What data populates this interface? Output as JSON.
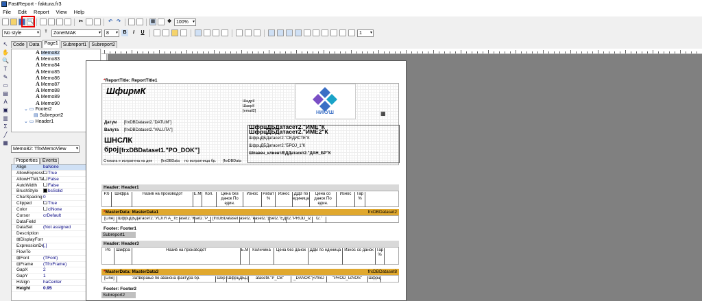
{
  "window": {
    "title": "FastReport - faktura.fr3"
  },
  "menu": [
    "File",
    "Edit",
    "Report",
    "View",
    "Help"
  ],
  "toolbar": {
    "zoom": "100%"
  },
  "format_bar": {
    "style": "No style",
    "font": "ZoneIMAK",
    "size": "8",
    "bold": "B",
    "italic": "I",
    "underline": "U",
    "frame_width": "1"
  },
  "design_tabs": [
    "Code",
    "Data",
    "Page1",
    "Subreport1",
    "Subreport2"
  ],
  "tree": {
    "items": [
      {
        "label": "Memo82",
        "type": "memo",
        "selected": true
      },
      {
        "label": "Memo83",
        "type": "memo"
      },
      {
        "label": "Memo84",
        "type": "memo"
      },
      {
        "label": "Memo85",
        "type": "memo"
      },
      {
        "label": "Memo86",
        "type": "memo"
      },
      {
        "label": "Memo87",
        "type": "memo"
      },
      {
        "label": "Memo88",
        "type": "memo"
      },
      {
        "label": "Memo89",
        "type": "memo"
      },
      {
        "label": "Memo90",
        "type": "memo"
      },
      {
        "label": "Footer2",
        "type": "band"
      },
      {
        "label": "Subreport2",
        "type": "sub"
      },
      {
        "label": "Header1",
        "type": "band"
      }
    ]
  },
  "object_combo": "Memo82: TfrxMemoView",
  "prop_tabs": [
    "Properties",
    "Events"
  ],
  "properties": [
    {
      "name": "Align",
      "value": "baNone"
    },
    {
      "name": "AllowExpress",
      "value": "True",
      "check": true
    },
    {
      "name": "AllowHTMLTa",
      "value": "False",
      "check": false
    },
    {
      "name": "AutoWidth",
      "value": "False",
      "check": false
    },
    {
      "name": "BrushStyle",
      "value": "bsSolid",
      "swatch": "#000000"
    },
    {
      "name": "CharSpacing",
      "value": "0"
    },
    {
      "name": "Clipped",
      "value": "True",
      "check": true
    },
    {
      "name": "Color",
      "value": "clNone",
      "swatch": "#ffffff"
    },
    {
      "name": "Cursor",
      "value": "crDefault"
    },
    {
      "name": "DataField",
      "value": ""
    },
    {
      "name": "DataSet",
      "value": "(Not assigned"
    },
    {
      "name": "Description",
      "value": ""
    },
    {
      "name": "⊞DisplayForma",
      "value": ""
    },
    {
      "name": "ExpressionDe",
      "value": "[,]"
    },
    {
      "name": "FlowTo",
      "value": ""
    },
    {
      "name": "⊞Font",
      "value": "(TFont)"
    },
    {
      "name": "⊟Frame",
      "value": "(TfrxFrame)"
    },
    {
      "name": "GapX",
      "value": "2"
    },
    {
      "name": "GapY",
      "value": "1"
    },
    {
      "name": "HAlign",
      "value": "haCenter"
    },
    {
      "name": "Height",
      "value": "0.95",
      "bold": true
    }
  ],
  "report": {
    "title_band": "ReportTitle: ReportTitle1",
    "firm": "ШфирмК",
    "logo_text": "НИКУШ",
    "addr_small": [
      "ШадрК",
      "ШаирК",
      "[email2]"
    ],
    "datum_label": "Датум",
    "datum_field": "[frxDBDataset2.\"DATUM\"]",
    "valuta_label": "Валута",
    "valuta_field": "[frxDBDataset2.\"VALUTA\"]",
    "doc_type": "ШНСЛК",
    "doc_no_label": "број",
    "doc_no_field": "[frxDBDataset1.\"PO_DOK\"]",
    "client_name": "ШфрцДБДатасет2.\"ИМЕ\"К",
    "client_name2": "ШфрцДБДатасет2.\"ИМЕ2\"К",
    "client_city": "ШфрцДБДатасет2.\"СЕДИСТЕ\"К",
    "client_no": "ШфрцДБДатасет2.\"БРОЈ_1\"К",
    "client_tax": "Шпавен_клиент/ЕДДатасет2.\"ДАН_БР\"К",
    "shipped_line": "Стоката е испратена на ден",
    "shipped_f1": "[frxDBData",
    "shipped_mid": "по испратница бр.",
    "shipped_f2": "[frxDBData",
    "header1_band": "Header: Header1",
    "header1_cols": [
      "Р.б",
      "Шифра",
      "Назив на производот",
      "Е.М",
      "Кол.",
      "Цена без данок По един.",
      "Износ",
      "Рабат %",
      "Износ",
      "ДДВ по единица",
      "Цена со данок По един.",
      "Износ",
      "Тар %"
    ],
    "master1_band": "MasterData: MasterData1",
    "master1_ds": "frxDBDataset2",
    "master1_row": [
      "[Line]",
      "ШфрцДБДатасет2.\"УСЛУГА_ТЕ",
      "aset2.\"КО",
      "set2.\"Р_С",
      "[frxDBDataset",
      "aset2.\"Р",
      "aset2.\"ро",
      "set2.\"ЕД_Р",
      "t2.\"PROD_IZ",
      "t2.\""
    ],
    "footer1_band": "Footer: Footer1",
    "subreport1": "Subreport1",
    "header3_band": "Header: Header3",
    "header3_cols": [
      "Р.б",
      "Шифра",
      "Назив на производот",
      "Е.М",
      "Количина",
      "Цена без данок",
      "ДДВ по единица",
      "Износ со данок",
      "Тар %"
    ],
    "master3_band": "MasterData: MasterData3",
    "master3_ds": "frxDBDataset8",
    "master3_row": [
      "[Line]",
      "Затворање по авансна фактура бр.",
      "Шер",
      "ШфрцДБД",
      "ataset8.\"Р_СВ\"",
      "_DANOK\"]</frxD",
      "\"PROD_IZNOS\"",
      "Шфрц"
    ],
    "footer2_band": "Footer: Footer2",
    "subreport2": "Subreport2"
  }
}
